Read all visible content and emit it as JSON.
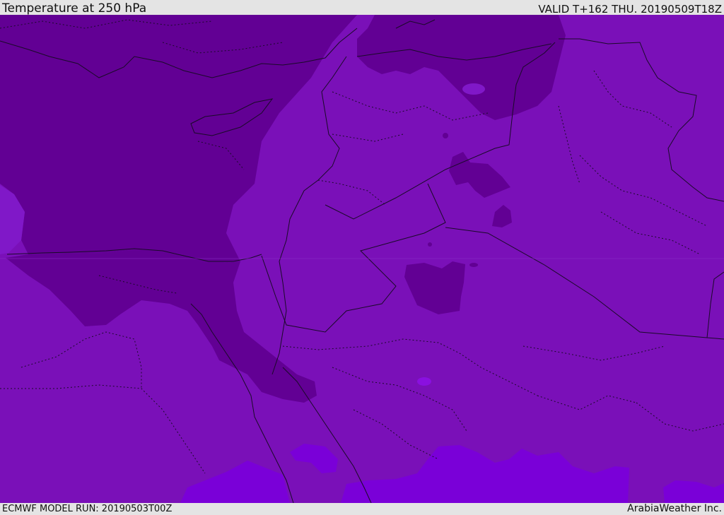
{
  "header": {
    "title": "Temperature at 250 hPa",
    "valid": "VALID T+162 THU. 20190509T18Z"
  },
  "footer": {
    "model_run": "ECMWF MODEL RUN: 20190503T00Z",
    "credit": "ArabiaWeather Inc."
  },
  "colors": {
    "coldest": "#620094",
    "cold": "#7010b0",
    "mid": "#7a10b8",
    "warm": "#7a00d8",
    "borders": "#1a0a28",
    "bars": "#e4e4e4"
  }
}
